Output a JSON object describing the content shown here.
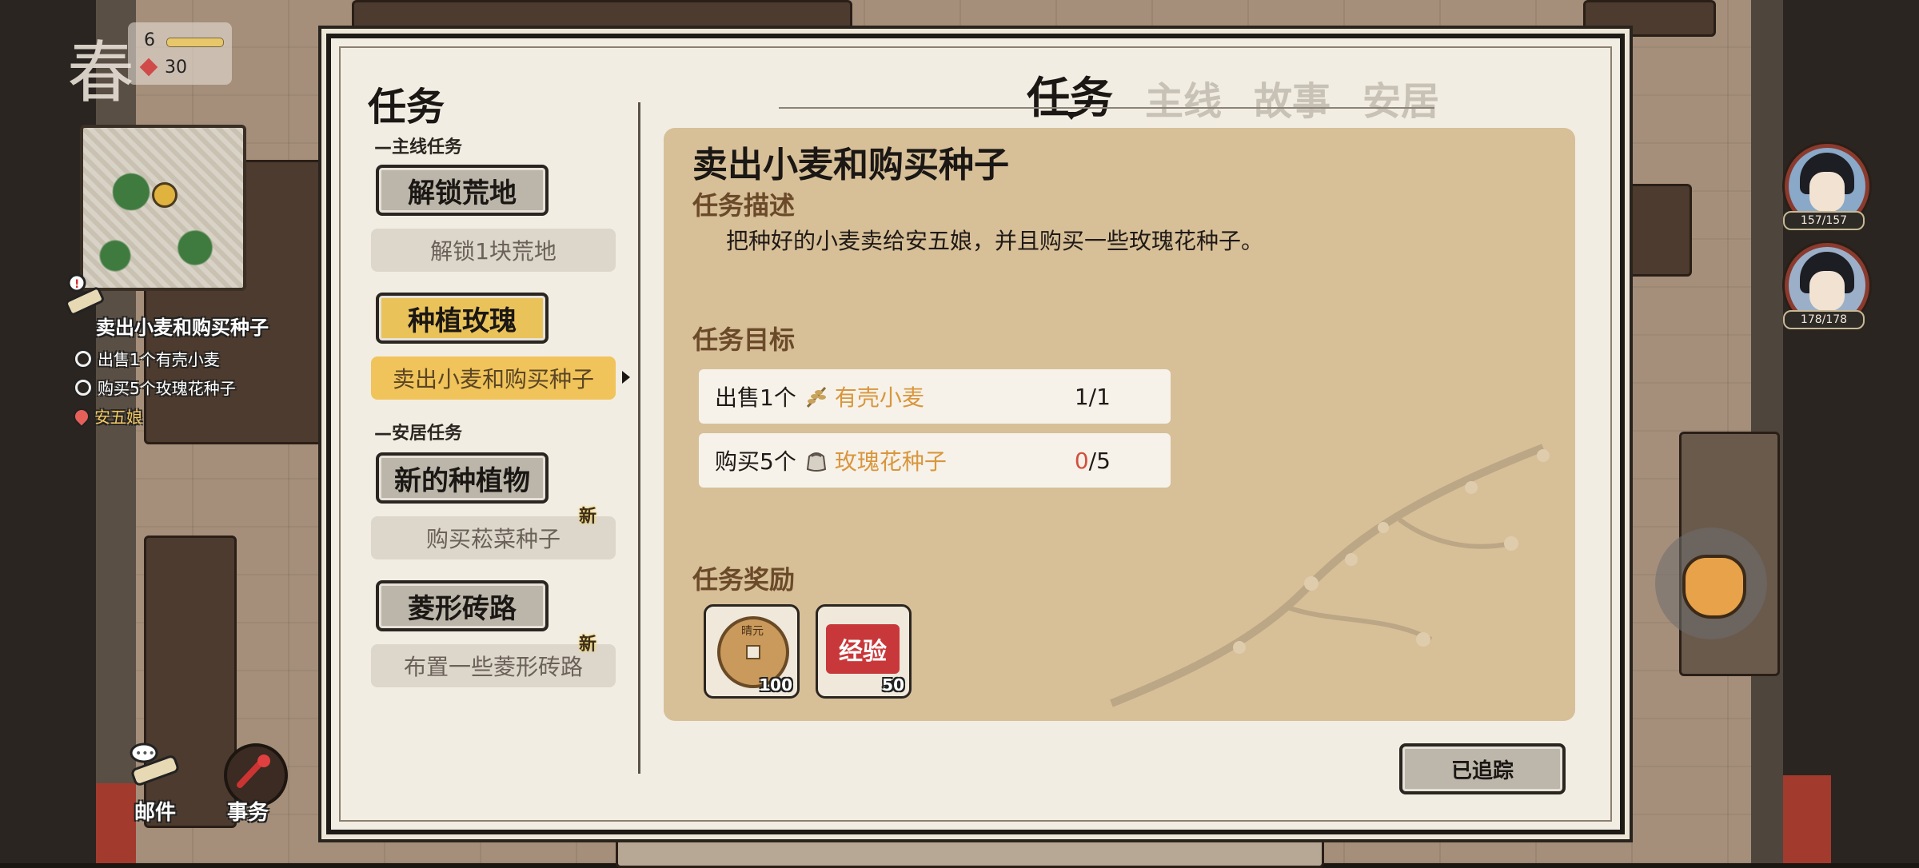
{
  "hud": {
    "season": "春",
    "stamina_count": "6",
    "gem_count": "30",
    "tracked_quest": {
      "title": "卖出小麦和购买种子",
      "objectives": [
        "出售1个有壳小麦",
        "购买5个玫瑰花种子"
      ],
      "npc": "安五娘"
    },
    "mail_label": "邮件",
    "affairs_label": "事务",
    "party": [
      {
        "hp": "157/157"
      },
      {
        "hp": "178/178"
      }
    ]
  },
  "dialog": {
    "left_title": "任务",
    "tabs": [
      {
        "label": "任务",
        "active": true
      },
      {
        "label": "主线",
        "active": false
      },
      {
        "label": "故事",
        "active": false
      },
      {
        "label": "安居",
        "active": false
      }
    ],
    "sections": [
      {
        "label": "—主线任务",
        "categories": [
          {
            "label": "解锁荒地",
            "active": false,
            "subs": [
              {
                "label": "解锁1块荒地",
                "active": false,
                "is_new": false
              }
            ]
          },
          {
            "label": "种植玫瑰",
            "active": true,
            "subs": [
              {
                "label": "卖出小麦和购买种子",
                "active": true,
                "is_new": false
              }
            ]
          }
        ]
      },
      {
        "label": "—安居任务",
        "categories": [
          {
            "label": "新的种植物",
            "active": false,
            "subs": [
              {
                "label": "购买菘菜种子",
                "active": false,
                "is_new": true
              }
            ]
          },
          {
            "label": "菱形砖路",
            "active": false,
            "subs": [
              {
                "label": "布置一些菱形砖路",
                "active": false,
                "is_new": true
              }
            ]
          }
        ]
      }
    ],
    "new_badge": "新",
    "detail": {
      "title": "卖出小麦和购买种子",
      "desc_heading": "任务描述",
      "description": "把种好的小麦卖给安五娘，并且购买一些玫瑰花种子。",
      "goals_heading": "任务目标",
      "goals": [
        {
          "action": "出售1个",
          "item": "有壳小麦",
          "icon": "wheat-icon",
          "current": "1",
          "total": "/1"
        },
        {
          "action": "购买5个",
          "item": "玫瑰花种子",
          "icon": "seed-bag-icon",
          "current": "0",
          "total": "/5"
        }
      ],
      "rewards_heading": "任务奖励",
      "rewards": [
        {
          "icon": "copper-coin-icon",
          "coin_text": "晴元",
          "qty": "100"
        },
        {
          "icon": "experience-stamp-icon",
          "stamp_text": "经验",
          "qty": "50"
        }
      ]
    },
    "track_button": "已追踪"
  },
  "colors": {
    "accent_gold": "#f0c45a",
    "item_orange": "#d9963c",
    "progress_red": "#d2503c",
    "panel_tan": "#d7bf98"
  }
}
